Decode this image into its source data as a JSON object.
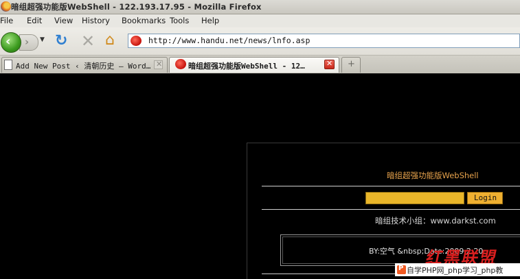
{
  "window": {
    "title": "暗组超强功能版WebShell - 122.193.17.95 - Mozilla Firefox"
  },
  "menu": [
    "File",
    "Edit",
    "View",
    "History",
    "Bookmarks",
    "Tools",
    "Help"
  ],
  "toolbar": {
    "back": "‹",
    "forward": "›",
    "history_drop": "▼",
    "reload": "↻",
    "stop": "✕",
    "home": "⌂",
    "url": "http://www.handu.net/news/lnfo.asp"
  },
  "tabs": [
    {
      "label": "Add New Post ‹ 清朝历史 — Word…",
      "close": "✕"
    },
    {
      "label": "暗组超强功能版WebShell - 12…",
      "close": "✕"
    }
  ],
  "new_tab": "+",
  "page": {
    "title": "暗组超强功能版WebShell",
    "login_label": "Login",
    "team": "暗组技术小组：www.darkst.com",
    "by_line": "BY:空气    &nbsp;Date:2009.2.20"
  },
  "watermark": {
    "logo": "红黑联盟",
    "badge": "P",
    "text": "自学PHP网_php学习_php教"
  },
  "colors": {
    "page_background": "#000000",
    "title_orange": "#e8a34c",
    "input_fill": "#e9b62a",
    "tab_close_red": "#c8281a"
  }
}
